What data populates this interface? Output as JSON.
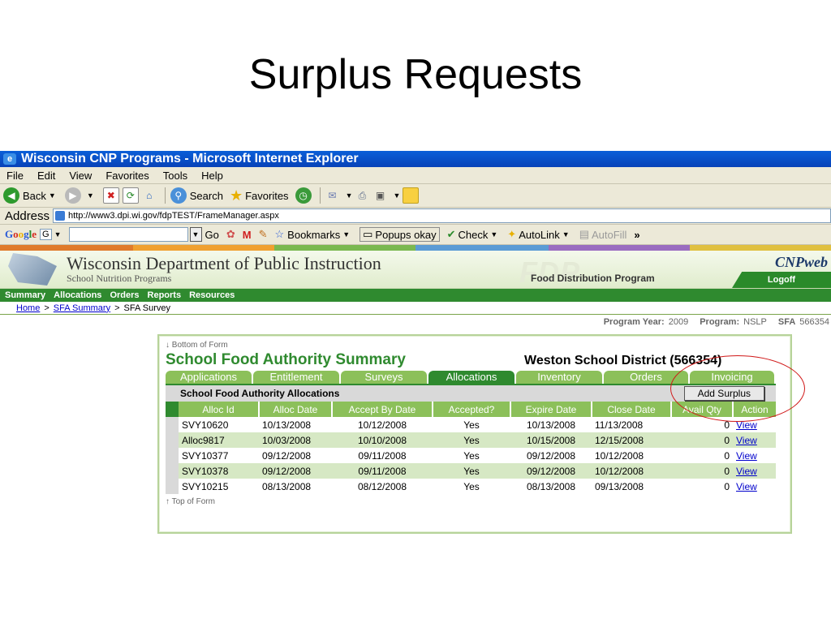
{
  "slide": {
    "title": "Surplus Requests"
  },
  "window": {
    "title": "Wisconsin CNP Programs - Microsoft Internet Explorer"
  },
  "menu": [
    "File",
    "Edit",
    "View",
    "Favorites",
    "Tools",
    "Help"
  ],
  "toolbar": {
    "back": "Back",
    "search": "Search",
    "favorites": "Favorites"
  },
  "address": {
    "label": "Address",
    "url": "http://www3.dpi.wi.gov/fdpTEST/FrameManager.aspx"
  },
  "googlebar": {
    "logo": "Google",
    "input_prefix": "G",
    "go": "Go",
    "bookmarks": "Bookmarks",
    "popups": "Popups okay",
    "check": "Check",
    "autolink": "AutoLink",
    "autofill": "AutoFill",
    "more": "»"
  },
  "banner": {
    "title": "Wisconsin Department of Public Instruction",
    "subtitle": "School Nutrition Programs",
    "fdp_logo": "FDP",
    "fdp_text": "Food Distribution Program",
    "cnp_logo": "CNPweb",
    "logoff": "Logoff"
  },
  "nav": [
    "Summary",
    "Allocations",
    "Orders",
    "Reports",
    "Resources"
  ],
  "breadcrumb": {
    "home": "Home",
    "sfa_summary": "SFA Summary",
    "current": "SFA Survey",
    "sep": ">"
  },
  "program_info": {
    "year_label": "Program Year:",
    "year": "2009",
    "program_label": "Program:",
    "program": "NSLP",
    "sfa_label": "SFA",
    "sfa": "566354"
  },
  "panel": {
    "bottom_link": "↓ Bottom of Form",
    "top_link": "↑ Top of Form",
    "title": "School Food Authority Summary",
    "district": "Weston School District (566354)",
    "tabs": [
      "Applications",
      "Entitlement",
      "Surveys",
      "Allocations",
      "Inventory",
      "Orders",
      "Invoicing"
    ],
    "section_label": "School Food Authority Allocations",
    "add_button": "Add Surplus"
  },
  "table": {
    "headers": [
      "Alloc Id",
      "Alloc Date",
      "Accept By Date",
      "Accepted?",
      "Expire Date",
      "Close Date",
      "Avail Qty",
      "Action"
    ],
    "rows": [
      {
        "id": "SVY10620",
        "alloc_date": "10/13/2008",
        "accept_by": "10/12/2008",
        "accepted": "Yes",
        "expire": "10/13/2008",
        "close": "11/13/2008",
        "qty": "0",
        "action": "View"
      },
      {
        "id": "Alloc9817",
        "alloc_date": "10/03/2008",
        "accept_by": "10/10/2008",
        "accepted": "Yes",
        "expire": "10/15/2008",
        "close": "12/15/2008",
        "qty": "0",
        "action": "View"
      },
      {
        "id": "SVY10377",
        "alloc_date": "09/12/2008",
        "accept_by": "09/11/2008",
        "accepted": "Yes",
        "expire": "09/12/2008",
        "close": "10/12/2008",
        "qty": "0",
        "action": "View"
      },
      {
        "id": "SVY10378",
        "alloc_date": "09/12/2008",
        "accept_by": "09/11/2008",
        "accepted": "Yes",
        "expire": "09/12/2008",
        "close": "10/12/2008",
        "qty": "0",
        "action": "View"
      },
      {
        "id": "SVY10215",
        "alloc_date": "08/13/2008",
        "accept_by": "08/12/2008",
        "accepted": "Yes",
        "expire": "08/13/2008",
        "close": "09/13/2008",
        "qty": "0",
        "action": "View"
      }
    ]
  },
  "colors": {
    "titlebar": "#0a5fd8",
    "nav_green": "#2f8a2f",
    "tab_green": "#8cc05a",
    "highlight": "#d01818"
  }
}
